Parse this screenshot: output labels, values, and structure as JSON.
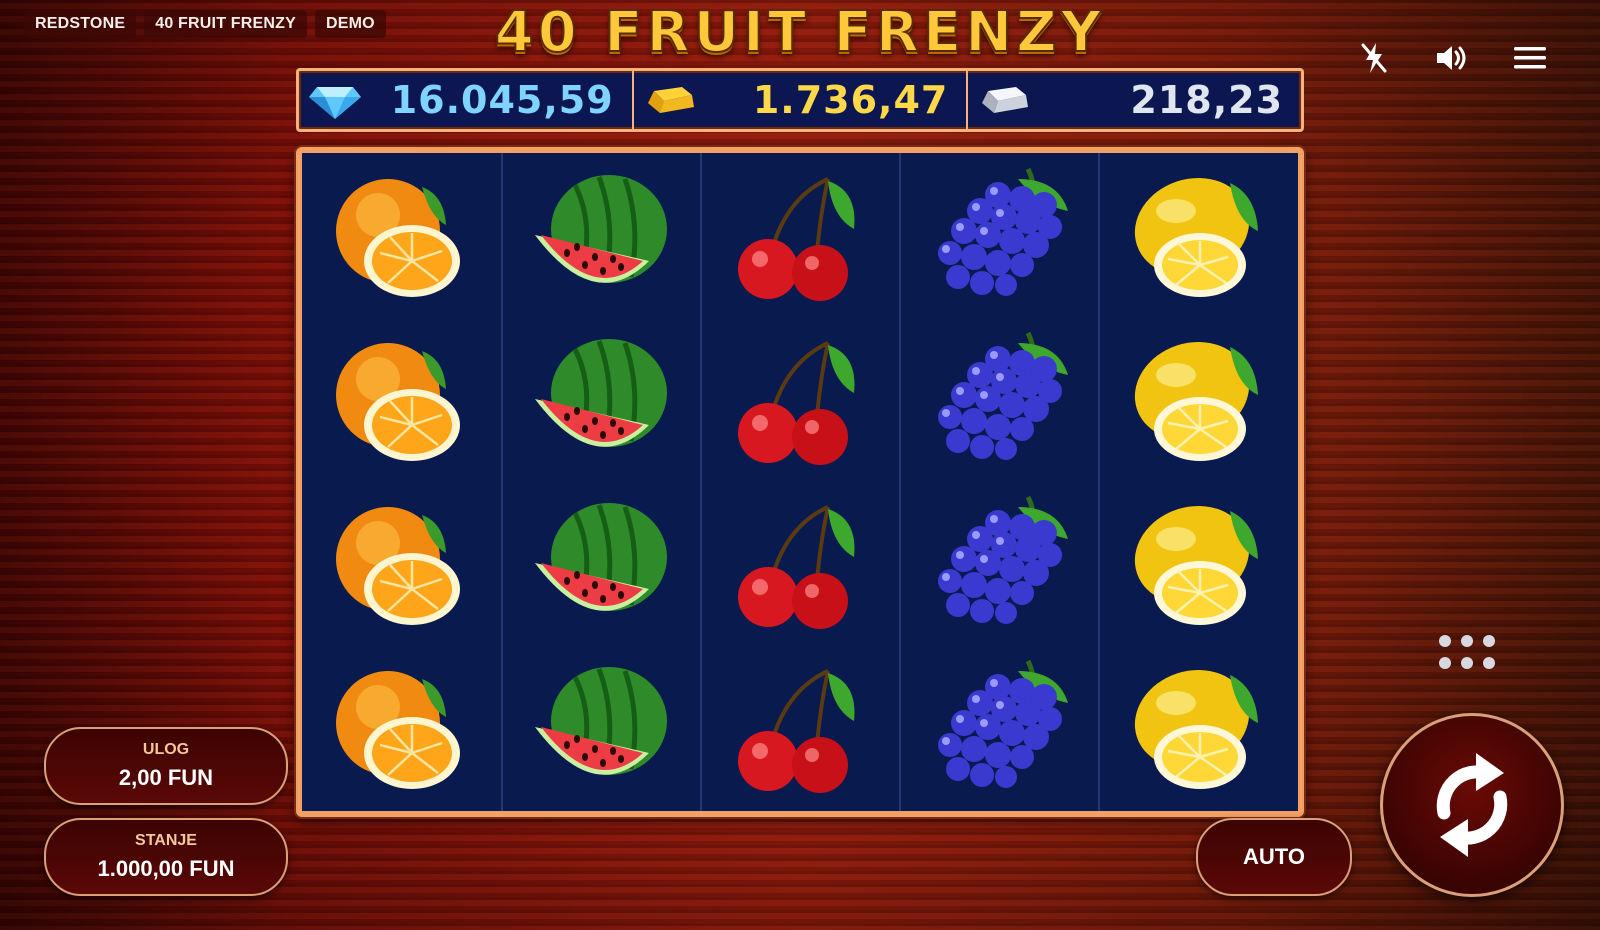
{
  "chips": [
    "REDSTONE",
    "40 FRUIT FRENZY",
    "DEMO"
  ],
  "title": "40 FRUIT FRENZY",
  "top_icons": [
    "lightning-off-icon",
    "volume-icon",
    "menu-icon"
  ],
  "jackpots": [
    {
      "icon": "diamond-icon",
      "value": "16.045,59",
      "color": "#7fd4ff"
    },
    {
      "icon": "gold-bar-icon",
      "value": "1.736,47",
      "color": "#ffd84a"
    },
    {
      "icon": "silver-bar-icon",
      "value": "218,23",
      "color": "#dfe6f0"
    }
  ],
  "reels": [
    [
      "orange",
      "orange",
      "orange",
      "orange"
    ],
    [
      "watermelon",
      "watermelon",
      "watermelon",
      "watermelon"
    ],
    [
      "cherry",
      "cherry",
      "cherry",
      "cherry"
    ],
    [
      "grapes",
      "grapes",
      "grapes",
      "grapes"
    ],
    [
      "lemon",
      "lemon",
      "lemon",
      "lemon"
    ]
  ],
  "bet": {
    "label": "ULOG",
    "value": "2,00 FUN"
  },
  "balance": {
    "label": "STANJE",
    "value": "1.000,00 FUN"
  },
  "auto_label": "AUTO",
  "colors": {
    "reel_bg": "#091a4e",
    "frame": "#f3a064",
    "title": "#ffc83a"
  }
}
